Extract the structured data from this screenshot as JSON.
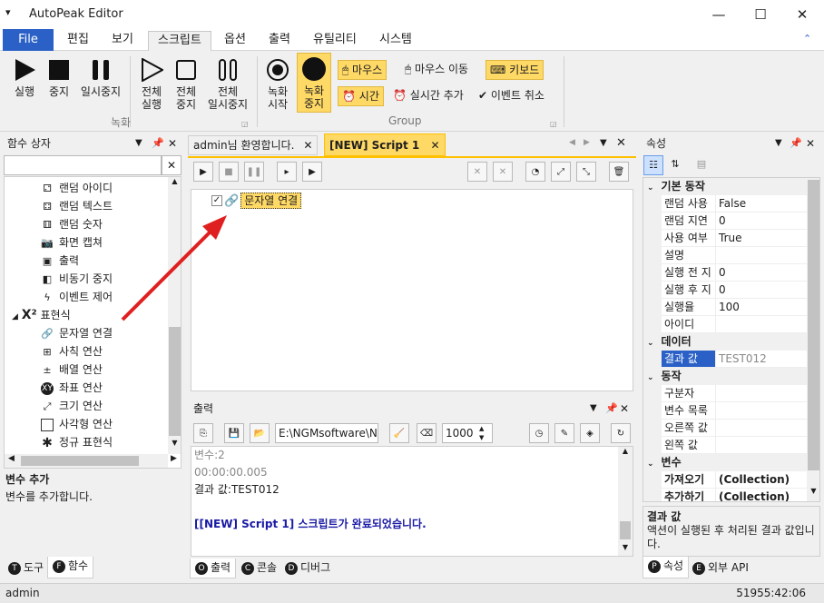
{
  "window": {
    "title": "AutoPeak Editor",
    "quick_access": "▾",
    "min": "—",
    "max": "☐",
    "close": "✕"
  },
  "menu": {
    "file": "File",
    "items": [
      "편집",
      "보기",
      "스크립트",
      "옵션",
      "출력",
      "유틸리티",
      "시스템"
    ],
    "active": "스크립트",
    "collapse": "⌃"
  },
  "ribbon": {
    "run": "실행",
    "stop": "중지",
    "pause": "일시중지",
    "all_run": [
      "전체",
      "실행"
    ],
    "all_stop": [
      "전체",
      "중지"
    ],
    "all_pause": [
      "전체",
      "일시중지"
    ],
    "rec_start": [
      "녹화",
      "시작"
    ],
    "rec_stop": [
      "녹화",
      "중지"
    ],
    "mouse": "마우스",
    "mouse_move": "마우스 이동",
    "keyboard": "키보드",
    "time": "시간",
    "realtime_add": "실시간 추가",
    "event_cancel": "이벤트 취소",
    "group1": "녹화",
    "group2": "Group"
  },
  "left": {
    "title": "함수 상자",
    "items": [
      "랜덤 아이디",
      "랜덤 텍스트",
      "랜덤 숫자",
      "화면 캡쳐",
      "출력",
      "비동기 중지",
      "이벤트 제어"
    ],
    "category": "표현식",
    "sub": [
      "문자열 연결",
      "사칙 연산",
      "배열 연산",
      "좌표 연산",
      "크기 연산",
      "사각형 연산",
      "정규 표현식"
    ],
    "desc_title": "변수 추가",
    "desc_text": "변수를 추가합니다.",
    "tabs": [
      "도구",
      "함수"
    ],
    "tab_letters": [
      "T",
      "F"
    ]
  },
  "doc": {
    "tabs": [
      "admin님 환영합니다.",
      "[NEW] Script 1"
    ],
    "node": "문자열 연결"
  },
  "output": {
    "title": "출력",
    "path": "E:\\NGMsoftware\\NG",
    "count": "1000",
    "lines": [
      "변수:2",
      "00:00:00.005",
      "결과 값:TEST012",
      "",
      "[[NEW] Script 1] 스크립트가 완료되었습니다."
    ],
    "tabs": [
      "출력",
      "콘솔",
      "디버그"
    ],
    "tab_letters": [
      "O",
      "C",
      "D"
    ]
  },
  "props": {
    "title": "속성",
    "cat_basic": "기본 동작",
    "basic": [
      [
        "랜덤 사용",
        "False"
      ],
      [
        "랜덤 지연",
        "0"
      ],
      [
        "사용 여부",
        "True"
      ],
      [
        "설명",
        ""
      ],
      [
        "실행 전 지",
        "0"
      ],
      [
        "실행 후 지",
        "0"
      ],
      [
        "실행율",
        "100"
      ],
      [
        "아이디",
        ""
      ]
    ],
    "cat_data": "데이터",
    "data": [
      [
        "결과 값",
        "TEST012"
      ]
    ],
    "cat_action": "동작",
    "action": [
      [
        "구분자",
        ""
      ],
      [
        "변수 목록",
        ""
      ],
      [
        "오른쪽 값",
        ""
      ],
      [
        "왼쪽 값",
        ""
      ]
    ],
    "cat_var": "변수",
    "var": [
      [
        "가져오기",
        "(Collection)"
      ],
      [
        "추가하기",
        "(Collection)"
      ]
    ],
    "desc_title": "결과 값",
    "desc_text": "액션이 실행된 후 처리된 결과 값입니다.",
    "tabs": [
      "속성",
      "외부 API"
    ],
    "tab_letters": [
      "P",
      "E"
    ]
  },
  "status": {
    "user": "admin",
    "time": "51955:42:06"
  },
  "colors": {
    "accent": "#2b61c6",
    "highlight": "#ffd966",
    "arrow": "#e02020",
    "output_blue": "#1a1aa6"
  }
}
